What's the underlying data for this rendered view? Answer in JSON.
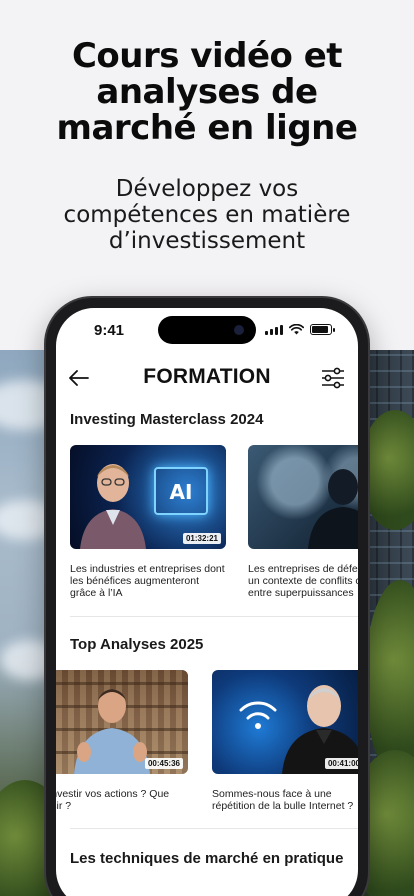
{
  "promo": {
    "title": "Cours vidéo et\nanalyses de\nmarché en ligne",
    "subtitle": "Développez vos\ncompétences en matière\nd’investissement"
  },
  "status_bar": {
    "time": "9:41",
    "icons": [
      "signal-icon",
      "wifi-icon",
      "battery-icon"
    ]
  },
  "app_bar": {
    "title": "FORMATION",
    "back_icon": "arrow-left-icon",
    "filter_icon": "sliders-icon"
  },
  "sections": [
    {
      "title": "Investing Masterclass 2024",
      "cards": [
        {
          "duration": "01:32:21",
          "text": "Les industries et entreprises dont\nles bénéfices augmenteront\ngrâce à l’IA",
          "thumb_label": "AI"
        },
        {
          "duration": "",
          "text": "Les entreprises de défense dans\nun contexte de conflits croissants\nentre superpuissances"
        }
      ]
    },
    {
      "title": "Top Analyses 2025",
      "cards": [
        {
          "duration": "00:45:36",
          "text": "Où investir vos actions ? Que choisir ?"
        },
        {
          "duration": "00:41:00",
          "text": "Sommes-nous face à une\nrépétition de la bulle Internet ?"
        }
      ]
    },
    {
      "title": "Les techniques de marché en pratique",
      "cards": []
    }
  ],
  "colors": {
    "page_bg": "#f3f2f4",
    "phone_frame": "#1b1b1d",
    "screen_bg": "#ffffff",
    "text": "#111111"
  }
}
